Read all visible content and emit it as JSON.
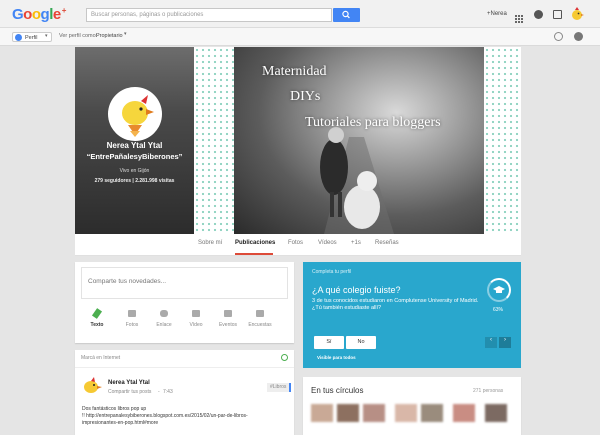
{
  "header": {
    "logo_parts": [
      "G",
      "o",
      "o",
      "g",
      "l",
      "e"
    ],
    "logo_plus": "+",
    "search_placeholder": "Buscar personas, páginas o publicaciones",
    "user_name": "+Nerea"
  },
  "subbar": {
    "profile_label": "Perfil",
    "view_as_label": "Ver perfil como:",
    "view_as_value": "Propietario"
  },
  "profile": {
    "name": "Nerea Ytal Ytal",
    "nickname": "“EntrePañalesyBiberones”",
    "location": "Vivo en Gijón",
    "followers": "279 seguidores",
    "views": "2.281.998 visitas"
  },
  "cover": {
    "line1": "Maternidad",
    "line2": "DIYs",
    "line3": "Tutoriales para bloggers"
  },
  "tabs": [
    "Sobre mí",
    "Publicaciones",
    "Fotos",
    "Vídeos",
    "+1s",
    "Reseñas"
  ],
  "active_tab": "Publicaciones",
  "composer": {
    "placeholder": "Comparte tus novedades...",
    "actions": [
      "Texto",
      "Fotos",
      "Enlace",
      "Vídeo",
      "Eventos",
      "Encuestas"
    ]
  },
  "post": {
    "source": "Marcá en Internet",
    "author": "Nerea Ytal Ytal",
    "visibility": "Compartir tus posts",
    "time": "7:43",
    "tag": "#Libros",
    "text_line1": "Dos fantásticos libros pop up",
    "text_line2": "!! http://entrepanalesybiberones.blogspot.com.es/2015/02/un-par-de-libros-",
    "text_line3": "impresionantes-en-pop.html#more"
  },
  "complete_profile": {
    "header": "Completa tu perfil",
    "question": "¿A qué colegio fuiste?",
    "description": "3 de tus conocidos estudiaron en Complutense University of Madrid. ¿Tú también estudiaste allí?",
    "percent": "63%",
    "yes_label": "Sí",
    "no_label": "No",
    "visibility": "Visible para todos"
  },
  "circles": {
    "title": "En tus círculos",
    "count": "271 personas"
  },
  "colors": {
    "accent_blue": "#4285f4",
    "teal": "#29a7cd",
    "google_red": "#dd4b39"
  }
}
